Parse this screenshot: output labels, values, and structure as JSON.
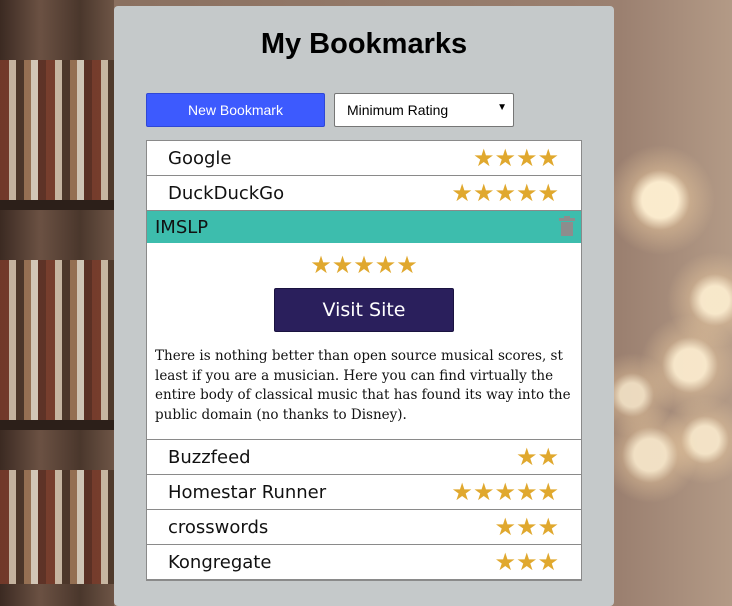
{
  "page": {
    "title": "My Bookmarks"
  },
  "toolbar": {
    "new_bookmark_label": "New Bookmark",
    "rating_filter": {
      "selected": "Minimum Rating"
    }
  },
  "colors": {
    "accent": "#3d5afe",
    "expanded_header": "#3dbdad",
    "visit_button": "#2a1f5c",
    "star": "#e0a82e",
    "panel": "#c5c9ca"
  },
  "bookmarks_before": [
    {
      "name": "Google",
      "rating": 4,
      "stars": "★★★★"
    },
    {
      "name": "DuckDuckGo",
      "rating": 5,
      "stars": "★★★★★"
    }
  ],
  "expanded": {
    "name": "IMSLP",
    "rating": 5,
    "stars": "★★★★★",
    "visit_label": "Visit Site",
    "description": "There is nothing better than open source musical scores, st least if you are a musician. Here you can find virtually the entire body of classical music that has found its way into the public domain (no thanks to Disney)."
  },
  "bookmarks_after": [
    {
      "name": "Buzzfeed",
      "rating": 2,
      "stars": "★★"
    },
    {
      "name": "Homestar Runner",
      "rating": 5,
      "stars": "★★★★★"
    },
    {
      "name": "crosswords",
      "rating": 3,
      "stars": "★★★"
    },
    {
      "name": "Kongregate",
      "rating": 3,
      "stars": "★★★"
    }
  ]
}
